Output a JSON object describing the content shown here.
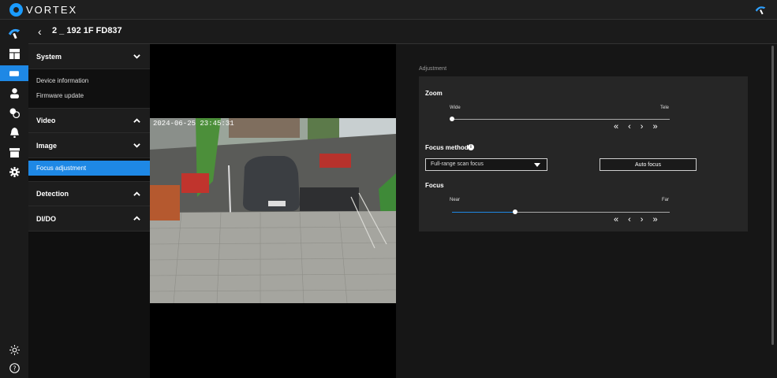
{
  "brand": {
    "name": "VORTEX"
  },
  "device": {
    "name": "2 _ 192 1F FD837"
  },
  "rail": {
    "icons": [
      "brand-swirl-icon",
      "dashboard-icon",
      "camera-icon",
      "user-icon",
      "tags-icon",
      "bell-icon",
      "archive-icon",
      "gear-icon",
      "brightness-icon",
      "help-icon"
    ],
    "active": "camera-icon"
  },
  "menu": {
    "sections": [
      {
        "label": "System",
        "expanded": true,
        "items": [
          "Device information",
          "Firmware update"
        ]
      },
      {
        "label": "Video",
        "expanded": false,
        "items": []
      },
      {
        "label": "Image",
        "expanded": true,
        "items": [
          "Focus adjustment"
        ]
      },
      {
        "label": "Detection",
        "expanded": false,
        "items": []
      },
      {
        "label": "DI/DO",
        "expanded": false,
        "items": []
      }
    ],
    "active_item": "Focus adjustment"
  },
  "video": {
    "timestamp": "2024-06-25 23:45:31"
  },
  "adjustment": {
    "title": "Adjustment",
    "zoom": {
      "label": "Zoom",
      "min_label": "Wide",
      "max_label": "Tele",
      "value": 0.0
    },
    "focus_method": {
      "label": "Focus method",
      "selected": "Full-range scan focus",
      "button": "Auto focus"
    },
    "focus": {
      "label": "Focus",
      "min_label": "Near",
      "max_label": "Far",
      "value": 0.29
    },
    "nav_glyphs": {
      "fast_back": "«",
      "back": "‹",
      "fwd": "›",
      "fast_fwd": "»"
    }
  },
  "colors": {
    "accent": "#1e88e5",
    "panel": "#262626",
    "background": "#161616"
  }
}
